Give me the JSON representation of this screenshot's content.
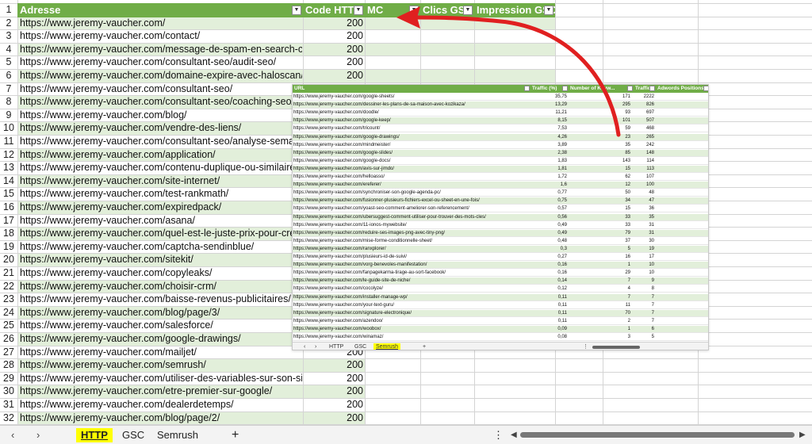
{
  "sheet": {
    "headers": [
      "Adresse",
      "Code HTTP",
      "MC",
      "Clics GSC",
      "Impression GSC"
    ],
    "row_numbers": [
      "1",
      "2",
      "3",
      "4",
      "5",
      "6",
      "7",
      "8",
      "9",
      "10",
      "11",
      "12",
      "13",
      "14",
      "15",
      "16",
      "17",
      "18",
      "19",
      "20",
      "21",
      "22",
      "23",
      "24",
      "25",
      "26",
      "27",
      "28",
      "29",
      "30",
      "31",
      "32"
    ],
    "rows": [
      {
        "url": "https://www.jeremy-vaucher.com/",
        "code": "200"
      },
      {
        "url": "https://www.jeremy-vaucher.com/contact/",
        "code": "200"
      },
      {
        "url": "https://www.jeremy-vaucher.com/message-de-spam-en-search-conso",
        "code": "200"
      },
      {
        "url": "https://www.jeremy-vaucher.com/consultant-seo/audit-seo/",
        "code": "200"
      },
      {
        "url": "https://www.jeremy-vaucher.com/domaine-expire-avec-haloscan/",
        "code": "200"
      },
      {
        "url": "https://www.jeremy-vaucher.com/consultant-seo/",
        "code": ""
      },
      {
        "url": "https://www.jeremy-vaucher.com/consultant-seo/coaching-seo/",
        "code": ""
      },
      {
        "url": "https://www.jeremy-vaucher.com/blog/",
        "code": ""
      },
      {
        "url": "https://www.jeremy-vaucher.com/vendre-des-liens/",
        "code": ""
      },
      {
        "url": "https://www.jeremy-vaucher.com/consultant-seo/analyse-semant",
        "code": ""
      },
      {
        "url": "https://www.jeremy-vaucher.com/application/",
        "code": ""
      },
      {
        "url": "https://www.jeremy-vaucher.com/contenu-duplique-ou-similaire/",
        "code": ""
      },
      {
        "url": "https://www.jeremy-vaucher.com/site-internet/",
        "code": ""
      },
      {
        "url": "https://www.jeremy-vaucher.com/test-rankmath/",
        "code": ""
      },
      {
        "url": "https://www.jeremy-vaucher.com/expiredpack/",
        "code": ""
      },
      {
        "url": "https://www.jeremy-vaucher.com/asana/",
        "code": ""
      },
      {
        "url": "https://www.jeremy-vaucher.com/quel-est-le-juste-prix-pour-cree",
        "code": ""
      },
      {
        "url": "https://www.jeremy-vaucher.com/captcha-sendinblue/",
        "code": ""
      },
      {
        "url": "https://www.jeremy-vaucher.com/sitekit/",
        "code": ""
      },
      {
        "url": "https://www.jeremy-vaucher.com/copyleaks/",
        "code": ""
      },
      {
        "url": "https://www.jeremy-vaucher.com/choisir-crm/",
        "code": ""
      },
      {
        "url": "https://www.jeremy-vaucher.com/baisse-revenus-publicitaires/",
        "code": ""
      },
      {
        "url": "https://www.jeremy-vaucher.com/blog/page/3/",
        "code": ""
      },
      {
        "url": "https://www.jeremy-vaucher.com/salesforce/",
        "code": ""
      },
      {
        "url": "https://www.jeremy-vaucher.com/google-drawings/",
        "code": ""
      },
      {
        "url": "https://www.jeremy-vaucher.com/mailjet/",
        "code": "200"
      },
      {
        "url": "https://www.jeremy-vaucher.com/semrush/",
        "code": "200"
      },
      {
        "url": "https://www.jeremy-vaucher.com/utiliser-des-variables-sur-son-site-c",
        "code": "200"
      },
      {
        "url": "https://www.jeremy-vaucher.com/etre-premier-sur-google/",
        "code": "200"
      },
      {
        "url": "https://www.jeremy-vaucher.com/dealerdetemps/",
        "code": "200"
      },
      {
        "url": "https://www.jeremy-vaucher.com/blog/page/2/",
        "code": "200"
      }
    ]
  },
  "tabs": {
    "nav_prev": "‹",
    "nav_next": "›",
    "http": "HTTP",
    "gsc": "GSC",
    "semrush": "Semrush",
    "add": "+",
    "more": "⋮"
  },
  "inset": {
    "headers": [
      "URL",
      "Traffic (%)",
      "Number of Keyw...",
      "Traffic",
      "Adwords Positions"
    ],
    "tabs": {
      "prev": "‹",
      "next": "›",
      "http": "HTTP",
      "gsc": "GSC",
      "semrush": "Semrush",
      "add": "+",
      "more": "⋮"
    },
    "rows": [
      {
        "url": "https://www.jeremy-vaucher.com/google-sheets/",
        "traffic_pct": "35,75",
        "keywords": "171",
        "traffic": "2222"
      },
      {
        "url": "https://www.jeremy-vaucher.com/dessiner-les-plans-de-sa-maison-avec-kozikaza/",
        "traffic_pct": "13,29",
        "keywords": "295",
        "traffic": "826"
      },
      {
        "url": "https://www.jeremy-vaucher.com/doodle/",
        "traffic_pct": "11,21",
        "keywords": "93",
        "traffic": "697"
      },
      {
        "url": "https://www.jeremy-vaucher.com/google-keep/",
        "traffic_pct": "8,15",
        "keywords": "101",
        "traffic": "507"
      },
      {
        "url": "https://www.jeremy-vaucher.com/tricount/",
        "traffic_pct": "7,53",
        "keywords": "59",
        "traffic": "468"
      },
      {
        "url": "https://www.jeremy-vaucher.com/google-drawings/",
        "traffic_pct": "4,26",
        "keywords": "23",
        "traffic": "265"
      },
      {
        "url": "https://www.jeremy-vaucher.com/mindmeister/",
        "traffic_pct": "3,89",
        "keywords": "35",
        "traffic": "242"
      },
      {
        "url": "https://www.jeremy-vaucher.com/google-slides/",
        "traffic_pct": "2,38",
        "keywords": "85",
        "traffic": "148"
      },
      {
        "url": "https://www.jeremy-vaucher.com/google-docs/",
        "traffic_pct": "1,83",
        "keywords": "143",
        "traffic": "114"
      },
      {
        "url": "https://www.jeremy-vaucher.com/avis-sur-jimdo/",
        "traffic_pct": "1,81",
        "keywords": "15",
        "traffic": "113"
      },
      {
        "url": "https://www.jeremy-vaucher.com/helloasso/",
        "traffic_pct": "1,72",
        "keywords": "62",
        "traffic": "107"
      },
      {
        "url": "https://www.jeremy-vaucher.com/ereferer/",
        "traffic_pct": "1,6",
        "keywords": "12",
        "traffic": "100"
      },
      {
        "url": "https://www.jeremy-vaucher.com/synchroniser-son-google-agenda-pc/",
        "traffic_pct": "0,77",
        "keywords": "50",
        "traffic": "48"
      },
      {
        "url": "https://www.jeremy-vaucher.com/fusionner-plusieurs-fichiers-excel-ou-sheet-en-une-fois/",
        "traffic_pct": "0,75",
        "keywords": "34",
        "traffic": "47"
      },
      {
        "url": "https://www.jeremy-vaucher.com/yoast-seo-comment-ameliorer-son-referencement/",
        "traffic_pct": "0,57",
        "keywords": "15",
        "traffic": "36"
      },
      {
        "url": "https://www.jeremy-vaucher.com/ubersuggest-comment-utiliser-pour-trouver-des-mots-cles/",
        "traffic_pct": "0,56",
        "keywords": "33",
        "traffic": "35"
      },
      {
        "url": "https://www.jeremy-vaucher.com/11-ionos-mywebsite/",
        "traffic_pct": "0,49",
        "keywords": "33",
        "traffic": "31"
      },
      {
        "url": "https://www.jeremy-vaucher.com/reduire-ses-images-png-avec-tiny-png/",
        "traffic_pct": "0,49",
        "keywords": "79",
        "traffic": "31"
      },
      {
        "url": "https://www.jeremy-vaucher.com/mise-forme-conditionnelle-sheet/",
        "traffic_pct": "0,48",
        "keywords": "37",
        "traffic": "30"
      },
      {
        "url": "https://www.jeremy-vaucher.com/ranxplorer/",
        "traffic_pct": "0,3",
        "keywords": "5",
        "traffic": "19"
      },
      {
        "url": "https://www.jeremy-vaucher.com/plusieurs-id-de-suivi/",
        "traffic_pct": "0,27",
        "keywords": "16",
        "traffic": "17"
      },
      {
        "url": "https://www.jeremy-vaucher.com/vorg-benevoles-manifestation/",
        "traffic_pct": "0,16",
        "keywords": "1",
        "traffic": "10"
      },
      {
        "url": "https://www.jeremy-vaucher.com/fanpagekarma-tirage-au-sort-facebook/",
        "traffic_pct": "0,16",
        "keywords": "29",
        "traffic": "10"
      },
      {
        "url": "https://www.jeremy-vaucher.com/le-guide-site-de-niche/",
        "traffic_pct": "0,14",
        "keywords": "7",
        "traffic": "9"
      },
      {
        "url": "https://www.jeremy-vaucher.com/cocolyze/",
        "traffic_pct": "0,12",
        "keywords": "4",
        "traffic": "8"
      },
      {
        "url": "https://www.jeremy-vaucher.com/installer-manage-wp/",
        "traffic_pct": "0,11",
        "keywords": "7",
        "traffic": "7"
      },
      {
        "url": "https://www.jeremy-vaucher.com/your-text-guru/",
        "traffic_pct": "0,11",
        "keywords": "11",
        "traffic": "7"
      },
      {
        "url": "https://www.jeremy-vaucher.com/signature-electronique/",
        "traffic_pct": "0,11",
        "keywords": "70",
        "traffic": "7"
      },
      {
        "url": "https://www.jeremy-vaucher.com/azendoo/",
        "traffic_pct": "0,11",
        "keywords": "2",
        "traffic": "7"
      },
      {
        "url": "https://www.jeremy-vaucher.com/woobox/",
        "traffic_pct": "0,09",
        "keywords": "1",
        "traffic": "6"
      },
      {
        "url": "https://www.jeremy-vaucher.com/winamaz/",
        "traffic_pct": "0,08",
        "keywords": "3",
        "traffic": "5"
      }
    ]
  },
  "annotation": {
    "arrow_color": "#e02020",
    "highlight_color": "#ffff00"
  },
  "colors": {
    "header_green": "#70ad47",
    "band_green": "#e2efda"
  }
}
